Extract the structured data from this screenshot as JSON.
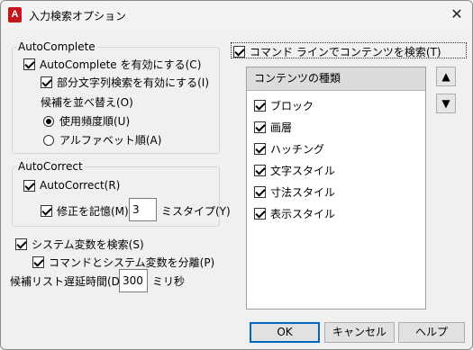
{
  "window": {
    "title": "入力検索オプション",
    "app_icon_letter": "A"
  },
  "autocomplete": {
    "legend": "AutoComplete",
    "enable_label": "AutoComplete を有効にする(C)",
    "enable_checked": true,
    "substring_label": "部分文字列検索を有効にする(I)",
    "substring_checked": true,
    "sort_label": "候補を並べ替え(O)",
    "sort_options": [
      {
        "label": "使用頻度順(U)",
        "selected": true
      },
      {
        "label": "アルファベット順(A)",
        "selected": false
      }
    ]
  },
  "autocorrect": {
    "legend": "AutoCorrect",
    "enable_label": "AutoCorrect(R)",
    "enable_checked": true,
    "remember_label": "修正を記憶(M)",
    "remember_checked": true,
    "typo_count": "3",
    "typo_label": "ミスタイプ(Y)"
  },
  "sysvar": {
    "search_label": "システム変数を検索(S)",
    "search_checked": true,
    "separate_label": "コマンドとシステム変数を分離(P)",
    "separate_checked": true
  },
  "delay": {
    "label": "候補リスト遅延時間(D)",
    "value": "300",
    "unit": "ミリ秒"
  },
  "content_search": {
    "label": "コマンド ラインでコンテンツを検索(T)",
    "checked": true,
    "list_header": "コンテンツの種類",
    "items": [
      {
        "label": "ブロック",
        "checked": true
      },
      {
        "label": "画層",
        "checked": true
      },
      {
        "label": "ハッチング",
        "checked": true
      },
      {
        "label": "文字スタイル",
        "checked": true
      },
      {
        "label": "寸法スタイル",
        "checked": true
      },
      {
        "label": "表示スタイル",
        "checked": true
      }
    ],
    "move_up_icon": "▲",
    "move_down_icon": "▼"
  },
  "buttons": {
    "ok": "OK",
    "cancel": "キャンセル",
    "help": "ヘルプ"
  }
}
